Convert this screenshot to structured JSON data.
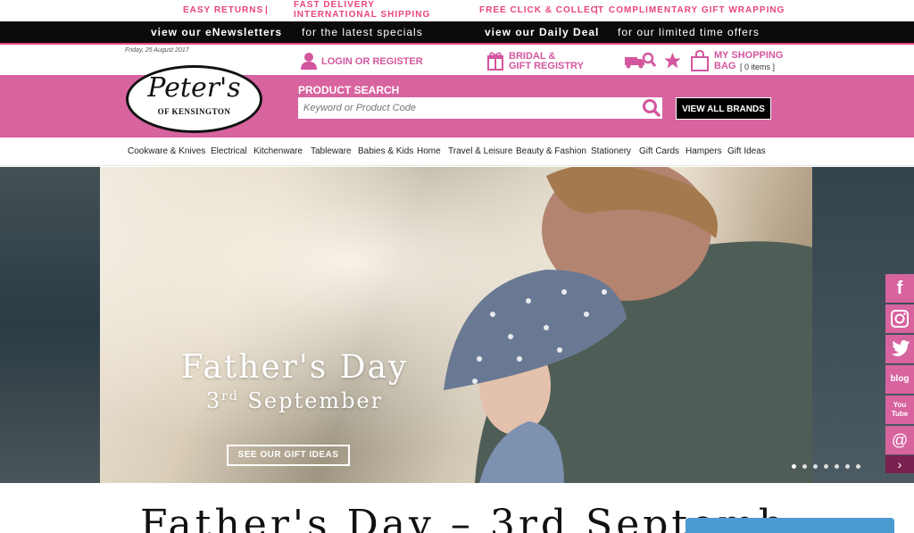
{
  "promo": {
    "easy_returns": "EASY RETURNS",
    "sep1": "|",
    "fast_delivery": "FAST DELIVERY",
    "intl_shipping": "INTERNATIONAL SHIPPING",
    "click_collect": "FREE CLICK & COLLECT",
    "sep2": "|",
    "gift_wrapping": "COMPLIMENTARY GIFT WRAPPING"
  },
  "blackbar": {
    "newsletter_bold": "view our eNewsletters",
    "newsletter_rest": "for the latest specials",
    "deal_bold": "view our Daily Deal",
    "deal_rest": "for our limited time offers"
  },
  "utility": {
    "date": "Friday, 25 August 2017",
    "login": "LOGIN OR REGISTER",
    "bridal_line1": "BRIDAL &",
    "bridal_line2": "GIFT REGISTRY",
    "bag_line1": "MY SHOPPING",
    "bag_line2": "BAG",
    "bag_items": "[ 0 items ]"
  },
  "header": {
    "logo_script": "Peter's",
    "logo_sub": "OF KENSINGTON",
    "search_label": "PRODUCT SEARCH",
    "search_placeholder": "Keyword or Product Code",
    "view_all_brands": "VIEW ALL BRANDS"
  },
  "nav": {
    "items": [
      "Cookware & Knives",
      "Electrical",
      "Kitchenware",
      "Tableware",
      "Babies & Kids",
      "Home",
      "Travel & Leisure",
      "Beauty & Fashion",
      "Stationery",
      "Gift Cards",
      "Hampers",
      "Gift Ideas"
    ]
  },
  "hero": {
    "title": "Father's Day",
    "sub_num": "3",
    "sub_sup": "rd",
    "sub_rest": "September",
    "cta": "SEE OUR GIFT IDEAS"
  },
  "social": {
    "facebook": "f",
    "blog": "blog",
    "youtube": "You Tube",
    "email": "@",
    "next": "›"
  },
  "bottom": {
    "title": "Father's Day – 3rd Septemb"
  },
  "colors": {
    "pink": "#d7639f",
    "promo_pink": "#e8457a",
    "black": "#0b0b0b"
  }
}
